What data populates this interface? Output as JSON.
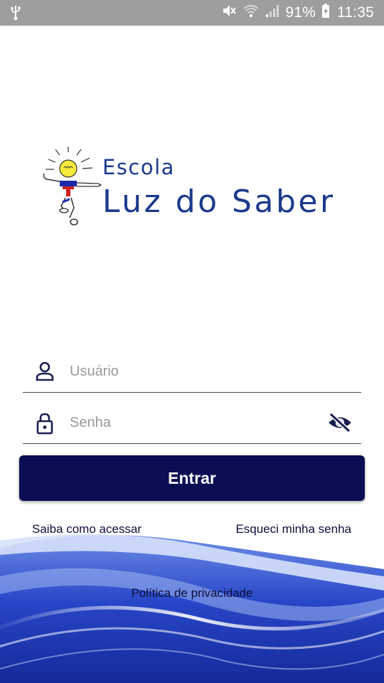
{
  "status_bar": {
    "battery_percent": "91%",
    "time": "11:35",
    "icons": [
      "usb-icon",
      "mute-icon",
      "wifi-icon",
      "signal-icon",
      "battery-charging-icon"
    ]
  },
  "logo": {
    "line1": "Escola",
    "line2": "Luz do Saber",
    "color": "#1c3a8c"
  },
  "form": {
    "username": {
      "value": "",
      "placeholder": "Usuário",
      "icon": "user-icon"
    },
    "password": {
      "value": "",
      "placeholder": "Senha",
      "icon": "lock-icon",
      "toggle_icon": "eye-off-icon"
    },
    "submit_label": "Entrar",
    "submit_color": "#0a0d52"
  },
  "links": {
    "how_to_access": "Saiba como acessar",
    "forgot_password": "Esqueci minha senha",
    "privacy_policy": "Política de privacidade"
  }
}
